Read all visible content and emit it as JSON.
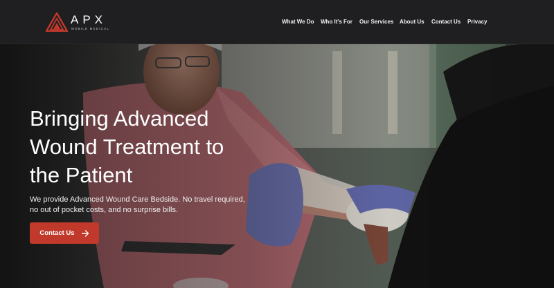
{
  "brand": {
    "name": "APX",
    "tagline": "MOBILE MEDICAL",
    "accent": "#c0392b"
  },
  "nav": {
    "items": [
      {
        "label": "What We Do"
      },
      {
        "label": "Who It's For"
      },
      {
        "label": "Our Services"
      },
      {
        "label": "About Us"
      },
      {
        "label": "Contact Us"
      },
      {
        "label": "Privacy"
      }
    ]
  },
  "hero": {
    "title": "Bringing Advanced Wound Treatment to the Patient",
    "subtitle": "We provide Advanced Wound Care Bedside. No travel required, no out of pocket costs, and no surprise bills.",
    "cta_label": "Contact Us",
    "cta_icon": "arrow-right-icon",
    "image": "healthcare worker bandaging patient's hand"
  }
}
